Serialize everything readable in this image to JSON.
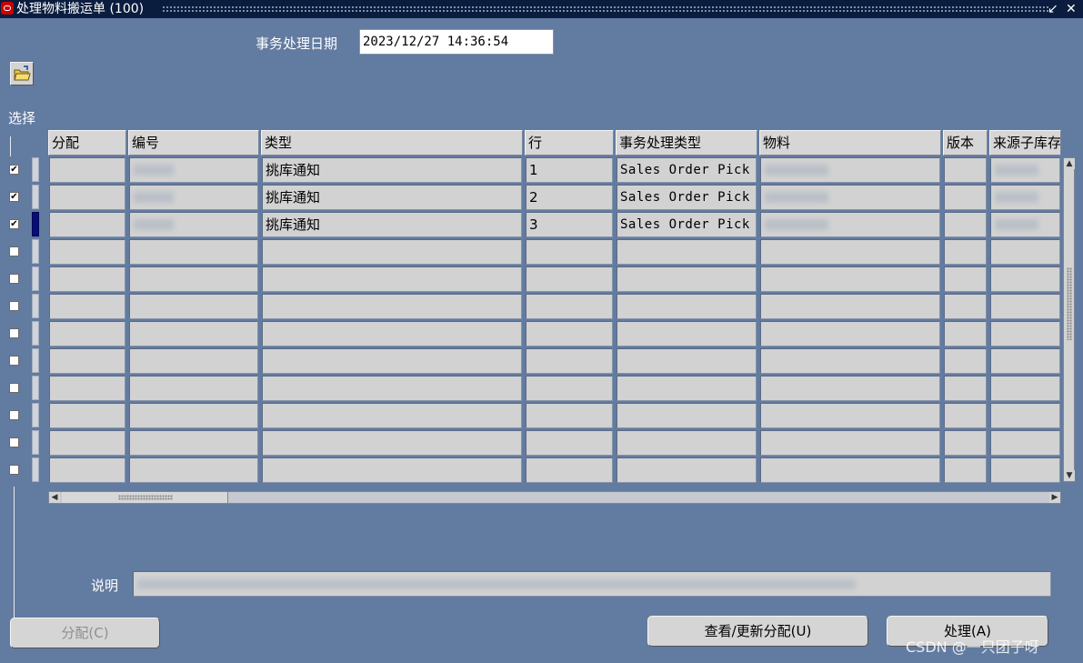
{
  "window": {
    "title": "处理物料搬运单 (100)",
    "min_label": "↙",
    "close_label": "✕"
  },
  "transaction_date": {
    "label": "事务处理日期",
    "value": "2023/12/27 14:36:54"
  },
  "select_label": "选择",
  "columns": [
    "分配",
    "编号",
    "类型",
    "行",
    "事务处理类型",
    "物料",
    "版本",
    "来源子库存"
  ],
  "rows": [
    {
      "checked": true,
      "type": "挑库通知",
      "line": "1",
      "txn_type": "Sales Order Pick"
    },
    {
      "checked": true,
      "type": "挑库通知",
      "line": "2",
      "txn_type": "Sales Order Pick"
    },
    {
      "checked": true,
      "type": "挑库通知",
      "line": "3",
      "txn_type": "Sales Order Pick"
    },
    {
      "checked": false
    },
    {
      "checked": false
    },
    {
      "checked": false
    },
    {
      "checked": false
    },
    {
      "checked": false
    },
    {
      "checked": false
    },
    {
      "checked": false
    },
    {
      "checked": false
    },
    {
      "checked": false
    }
  ],
  "description_label": "说明",
  "buttons": {
    "allocate": "分配(C)",
    "view_update": "查看/更新分配(U)",
    "process": "处理(A)"
  },
  "watermark": "CSDN @一只团子呀",
  "icons": {
    "folder": "folder-open-icon"
  }
}
